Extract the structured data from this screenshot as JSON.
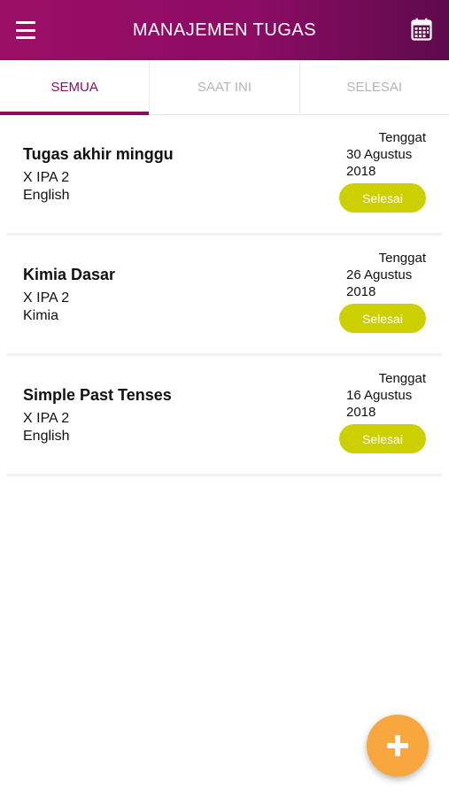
{
  "appbar": {
    "title": "MANAJEMEN TUGAS",
    "menu_icon": "hamburger-menu-icon",
    "calendar_icon": "calendar-icon",
    "gradient": [
      "#9c0e66",
      "#5e0a4c"
    ]
  },
  "tabs": [
    {
      "label": "SEMUA",
      "active": true
    },
    {
      "label": "SAAT INI",
      "active": false
    },
    {
      "label": "SELESAI",
      "active": false
    }
  ],
  "tasks": [
    {
      "title": "Tugas akhir minggu",
      "class": "X IPA 2",
      "subject": "English",
      "due_label": "Tenggat",
      "due_date": "30 Agustus 2018",
      "button": "Selesai"
    },
    {
      "title": "Kimia Dasar",
      "class": "X IPA 2",
      "subject": "Kimia",
      "due_label": "Tenggat",
      "due_date": "26 Agustus 2018",
      "button": "Selesai"
    },
    {
      "title": "Simple Past Tenses",
      "class": "X IPA 2",
      "subject": "English",
      "due_label": "Tenggat",
      "due_date": "16 Agustus 2018",
      "button": "Selesai"
    }
  ],
  "fab": {
    "icon": "plus-icon",
    "color": "#f7a73d"
  },
  "colors": {
    "accent": "#8c0c64",
    "done_button": "#cdd000"
  }
}
